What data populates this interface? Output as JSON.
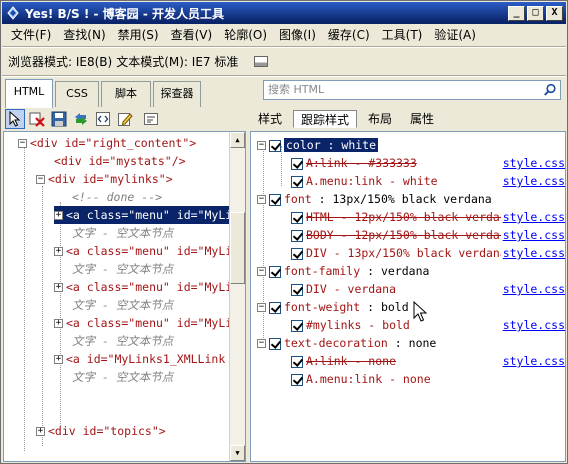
{
  "window": {
    "title": "Yes! B/S ! - 博客园 - 开发人员工具",
    "min_label": "_",
    "max_label": "□",
    "close_label": "X"
  },
  "menu": [
    "文件(F)",
    "查找(N)",
    "禁用(S)",
    "查看(V)",
    "轮廓(O)",
    "图像(I)",
    "缓存(C)",
    "工具(T)",
    "验证(A)"
  ],
  "modebar": {
    "browser_mode": "浏览器模式: IE8(B)",
    "doc_mode": "文本模式(M): IE7 标准"
  },
  "tabs": [
    "HTML",
    "CSS",
    "脚本",
    "探查器"
  ],
  "search": {
    "placeholder": "搜索 HTML"
  },
  "subtabs": [
    "样式",
    "跟踪样式",
    "布局",
    "属性"
  ],
  "tree": [
    {
      "t": "<div id=\"right_content\">"
    },
    {
      "t": "<div id=\"mystats\"/>"
    },
    {
      "t": "<div id=\"mylinks\">"
    },
    {
      "t": "<!-- done -->"
    },
    {
      "t": "<a class=\"menu\" id=\"MyLi"
    },
    {
      "t": "文字 - 空文本节点"
    },
    {
      "t": "<a class=\"menu\" id=\"MyLi"
    },
    {
      "t": "文字 - 空文本节点"
    },
    {
      "t": "<a class=\"menu\" id=\"MyLi"
    },
    {
      "t": "文字 - 空文本节点"
    },
    {
      "t": "<a class=\"menu\" id=\"MyLi"
    },
    {
      "t": "文字 - 空文本节点"
    },
    {
      "t": "<a id=\"MyLinks1_XMLLink"
    },
    {
      "t": "文字 - 空文本节点"
    },
    {
      "t": "<div id=\"topics\">"
    }
  ],
  "styles": [
    {
      "prop": "color",
      "value": "white"
    },
    {
      "rule": "A:link - #333333",
      "struck": true,
      "src": "style.css"
    },
    {
      "rule": "A.menu:link - white",
      "struck": false,
      "src": "style.css"
    },
    {
      "prop": "font",
      "value": "13px/150% black verdana"
    },
    {
      "rule": "HTML - 12px/150% black verdana",
      "struck": true,
      "src": "style.css"
    },
    {
      "rule": "BODY - 12px/150% black verdana",
      "struck": true,
      "src": "style.css"
    },
    {
      "rule": "DIV - 13px/150% black verdana",
      "struck": false,
      "src": "style.css"
    },
    {
      "prop": "font-family",
      "value": "verdana"
    },
    {
      "rule": "DIV - verdana",
      "struck": false,
      "src": "style.css"
    },
    {
      "prop": "font-weight",
      "value": "bold"
    },
    {
      "rule": "#mylinks - bold",
      "struck": false,
      "src": "style.css"
    },
    {
      "prop": "text-decoration",
      "value": "none"
    },
    {
      "rule": "A:link - none",
      "struck": true,
      "src": "style.css"
    },
    {
      "rule": "A.menu:link - none",
      "struck": false,
      "src": ""
    }
  ]
}
